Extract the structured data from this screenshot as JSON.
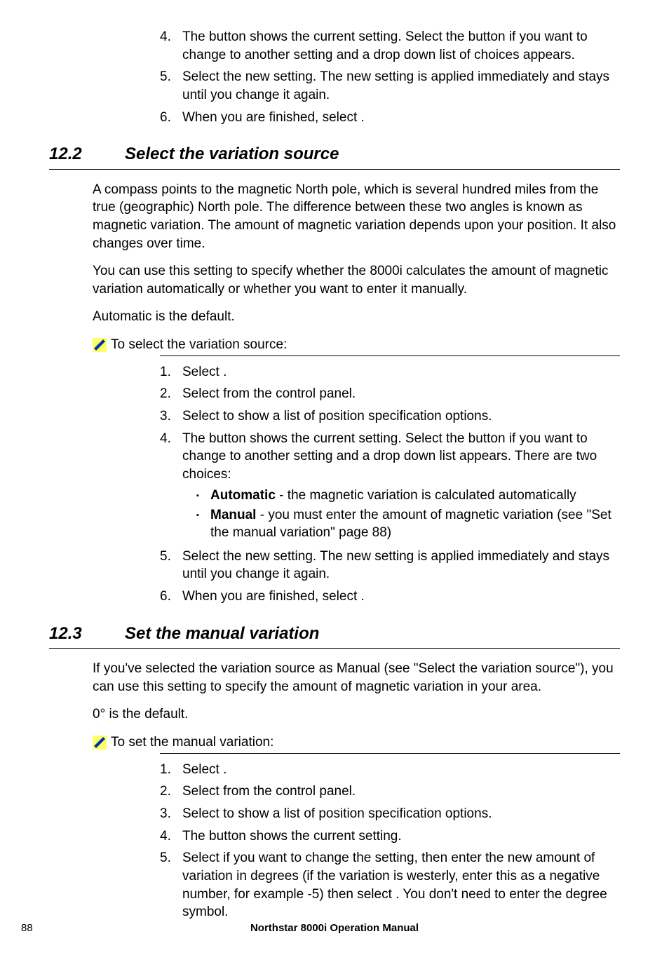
{
  "block1": {
    "items": [
      {
        "n": "4.",
        "text_before": "The ",
        "text_after": " button shows the current setting. Select the button if you want to change to another setting and a drop down list of choices appears."
      },
      {
        "n": "5.",
        "text": "Select the new setting. The new setting is applied immediately and stays until you change it again."
      },
      {
        "n": "6.",
        "text_before": "When you are finished, select ",
        "text_after": "."
      }
    ]
  },
  "section12_2": {
    "num": "12.2",
    "title": "Select the variation source",
    "para1": "A compass points to the magnetic North pole, which is several hundred miles from the true (geographic) North pole. The difference between these two angles is known as magnetic variation. The amount of magnetic variation depends upon your position. It also changes over time.",
    "para2": "You can use this setting to specify whether the 8000i calculates the amount of magnetic variation automatically or whether you want to enter it manually.",
    "para3": "Automatic is the default.",
    "proc_label": "To select the variation source:",
    "steps": [
      {
        "n": "1.",
        "a": "Select ",
        "b": "."
      },
      {
        "n": "2.",
        "a": "Select ",
        "b": " from the control panel."
      },
      {
        "n": "3.",
        "a": "Select ",
        "b": " to show a list of position specification options."
      },
      {
        "n": "4.",
        "a": "The ",
        "b": " button shows the current setting. Select the button if you want to change to another setting and a drop down list appears. There are two choices:"
      },
      {
        "n": "5.",
        "a": "Select the new setting. The new setting is applied immediately and stays until you change it again."
      },
      {
        "n": "6.",
        "a": "When you are finished, select ",
        "b": "."
      }
    ],
    "bullets": [
      {
        "bold": "Automatic",
        "rest": " - the magnetic variation is calculated automatically"
      },
      {
        "bold": "Manual",
        "rest": " - you must enter the amount of magnetic variation (see \"Set the manual variation\" page 88)"
      }
    ]
  },
  "section12_3": {
    "num": "12.3",
    "title": "Set the manual variation",
    "para1": "If you've selected the variation source as Manual (see \"Select the variation source\"), you can use this setting to specify the amount of magnetic variation in your area.",
    "para2": "0° is the default.",
    "proc_label": "To set the manual variation:",
    "steps": [
      {
        "n": "1.",
        "a": "Select ",
        "b": "."
      },
      {
        "n": "2.",
        "a": "Select ",
        "b": " from the control panel."
      },
      {
        "n": "3.",
        "a": "Select ",
        "b": " to show a list of position specification options."
      },
      {
        "n": "4.",
        "a": "The ",
        "b": " button shows the current setting."
      },
      {
        "n": "5.",
        "a": "Select ",
        "b": " if you want to change the setting, then enter the new amount of variation in degrees (if the variation is westerly, enter this as a negative number, for example -5) then select ",
        "c": ". You don't need to enter the degree symbol."
      }
    ]
  },
  "footer": {
    "page": "88",
    "title": "Northstar 8000i Operation Manual"
  }
}
